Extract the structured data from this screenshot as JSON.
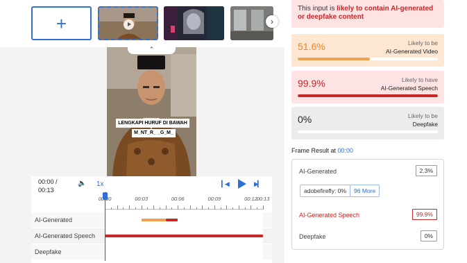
{
  "thumbnails": {
    "add_label": "+",
    "next_label": "›"
  },
  "video": {
    "collapse_label": "⌃",
    "caption_line1": "LENGKAPI HURUF DI BAWAH",
    "caption_line2": "M_NT_R_ _G_M_"
  },
  "player": {
    "time_current": "00:00 /",
    "time_total": "00:13",
    "volume_icon": "🔈",
    "speed_label": "1x",
    "prev_label": "▎◀",
    "next_label": "▶▎",
    "ruler_labels": [
      "00:00",
      "00:03",
      "00:06",
      "00:09",
      "00:12",
      "00:13"
    ],
    "tracks": [
      {
        "label": "AI-Generated"
      },
      {
        "label": "AI-Generated Speech"
      },
      {
        "label": "Deepfake"
      }
    ]
  },
  "timeline_data": {
    "duration_s": 13,
    "ruler_seconds": [
      0,
      3,
      6,
      9,
      12,
      13
    ],
    "segments": [
      {
        "track": 0,
        "start_s": 3.0,
        "end_s": 5.0,
        "color": "#f0a050"
      },
      {
        "track": 0,
        "start_s": 5.0,
        "end_s": 6.0,
        "color": "#c62828"
      },
      {
        "track": 1,
        "start_s": 0.0,
        "end_s": 13.0,
        "color": "#c62828"
      }
    ]
  },
  "verdict": {
    "prefix": "This input is ",
    "highlight": "likely to contain AI-generated or deepfake content"
  },
  "metrics": [
    {
      "value": "51.6%",
      "fraction": 0.516,
      "cap_top": "Likely to be",
      "cap_bottom": "AI-Generated Video",
      "value_color": "#e8892c",
      "bar_color": "#f0a050"
    },
    {
      "value": "99.9%",
      "fraction": 0.999,
      "cap_top": "Likely to have",
      "cap_bottom": "AI-Generated Speech",
      "value_color": "#c62828",
      "bar_color": "#c62828"
    },
    {
      "value": "0%",
      "fraction": 0.0,
      "cap_top": "Likely to be",
      "cap_bottom": "Deepfake",
      "value_color": "#222222",
      "bar_color": "#999999"
    }
  ],
  "frame_result": {
    "title": "Frame Result at ",
    "time": "00:00",
    "ai_generated_label": "AI-Generated",
    "ai_generated_value": "2.3%",
    "chip_label": "adobefirefly: 0%",
    "more_label": "96 More",
    "speech_label": "AI-Generated Speech",
    "speech_value": "99.9%",
    "deepfake_label": "Deepfake",
    "deepfake_value": "0%"
  },
  "colors": {
    "accent": "#2f6fd6",
    "danger": "#c62828",
    "warning": "#e8892c"
  }
}
